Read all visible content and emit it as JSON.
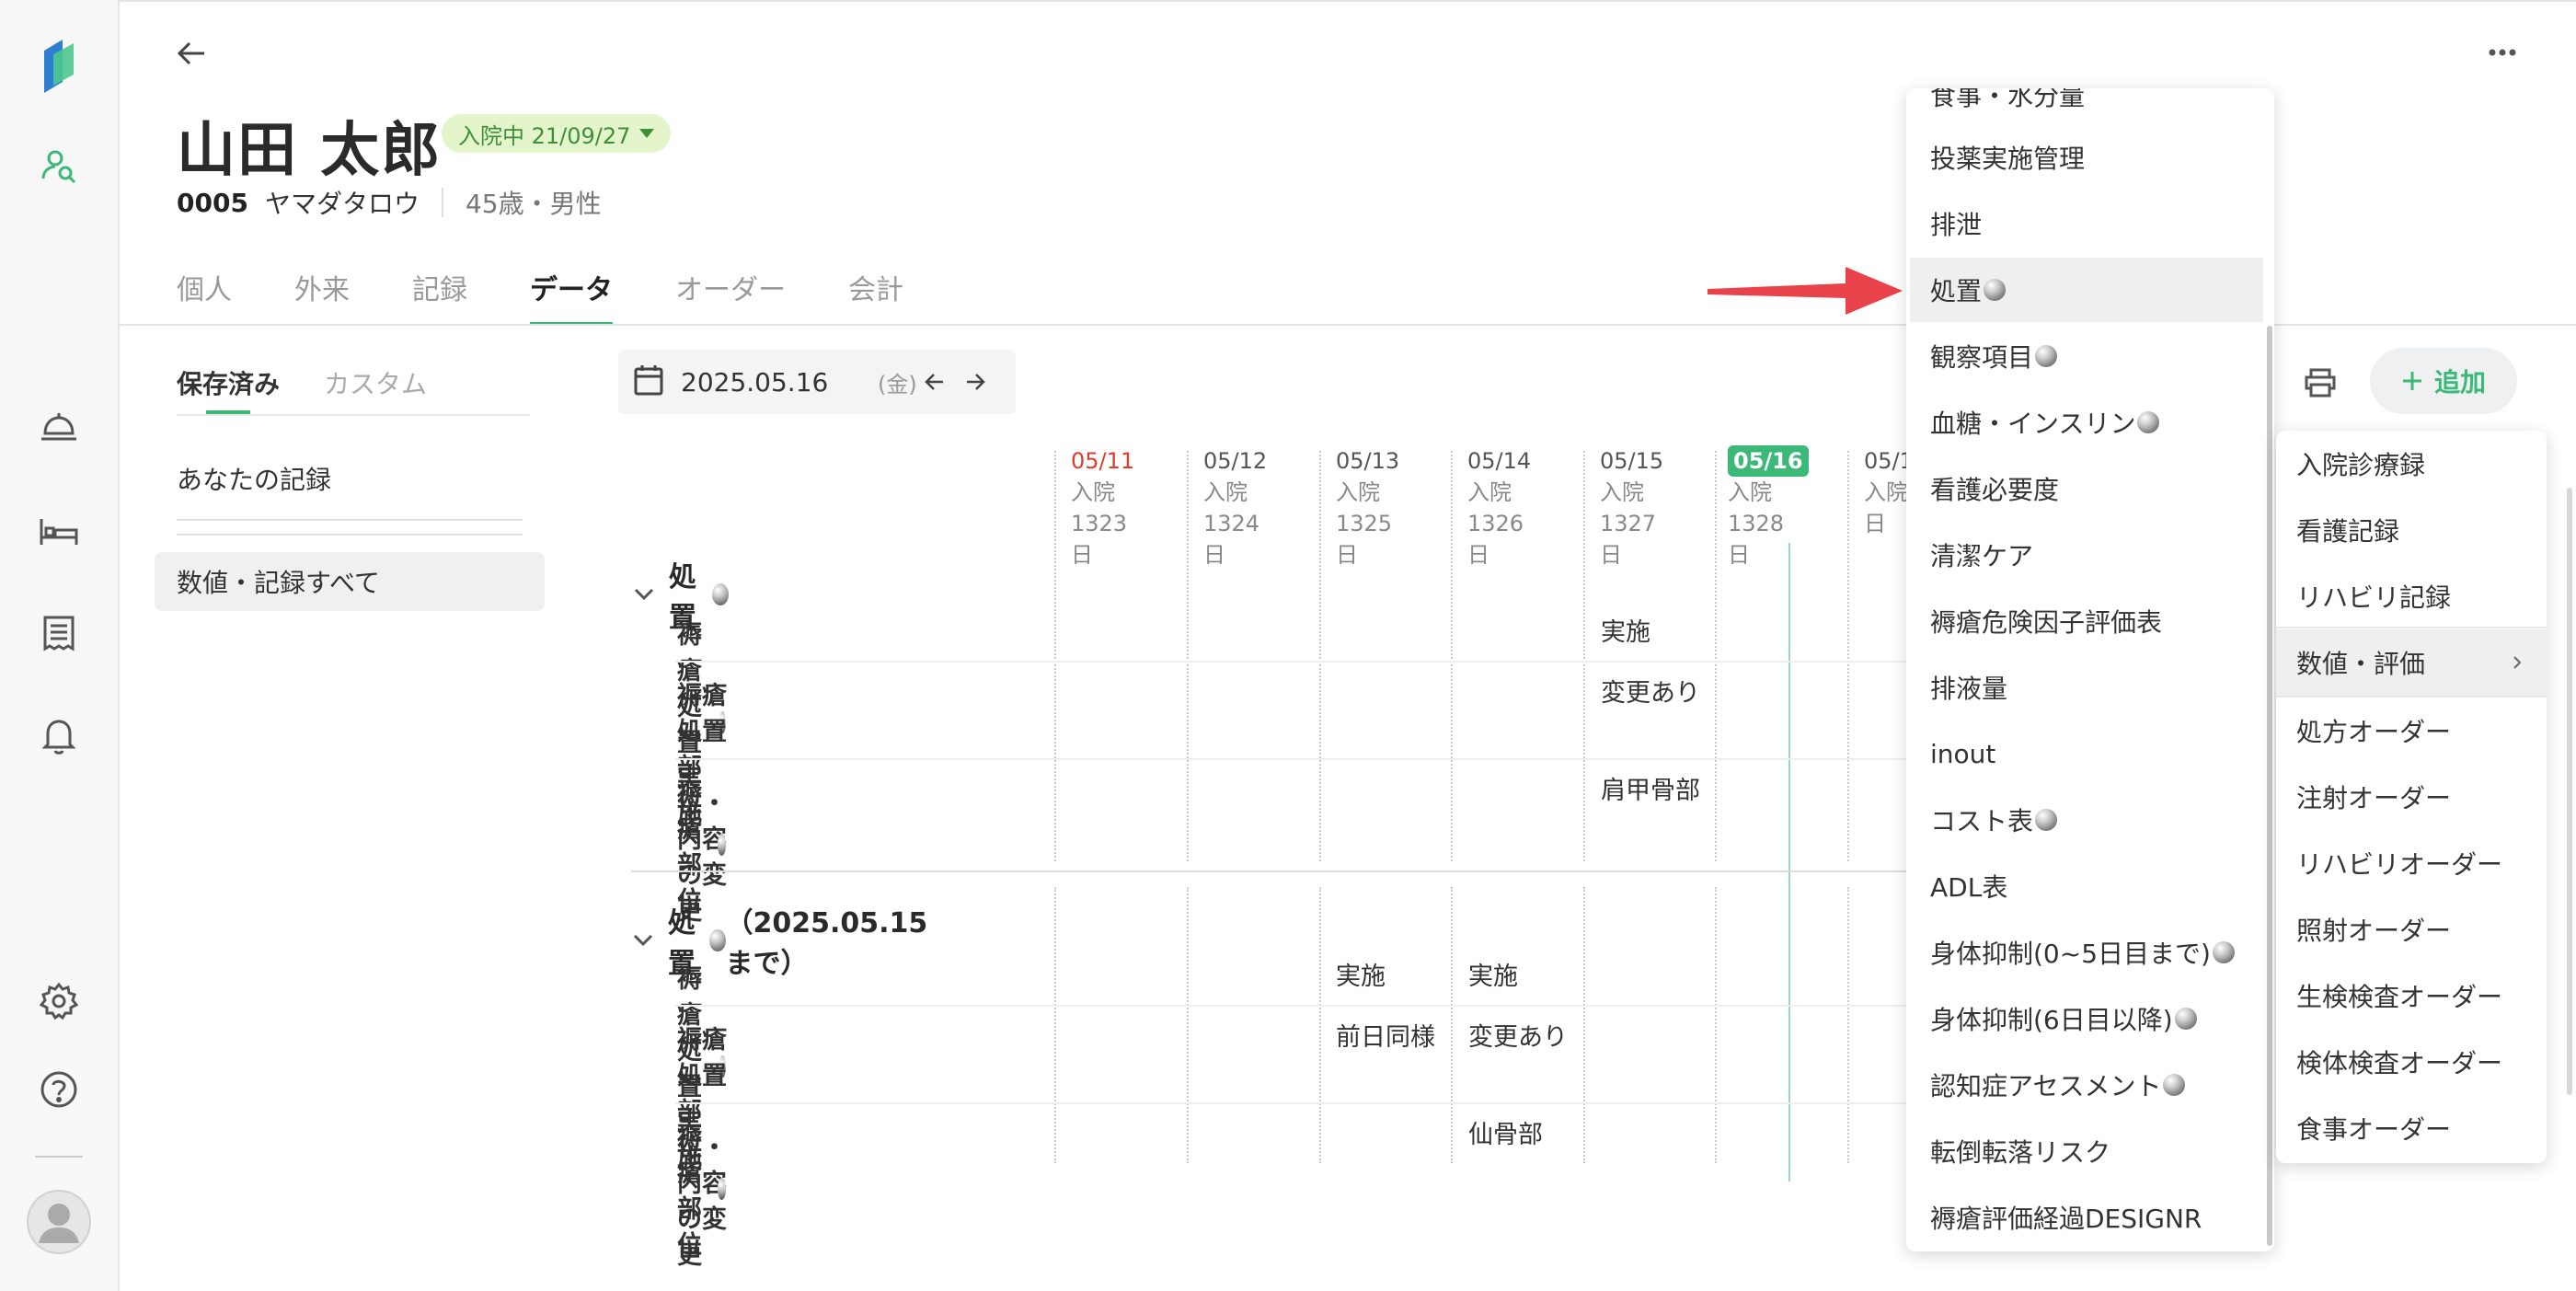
{
  "sidebar": {
    "icons": [
      "app-logo",
      "patient-search-icon",
      "bell-desk-icon",
      "bed-icon",
      "receipt-icon",
      "notification-bell-icon",
      "gear-icon",
      "help-icon",
      "avatar"
    ]
  },
  "header": {
    "patient_name": "山田 太郎",
    "status_badge": "入院中 21/09/27",
    "patient_id": "0005",
    "patient_kana": "ヤマダタロウ",
    "age_sex": "45歳・男性"
  },
  "tabs": [
    {
      "label": "個人"
    },
    {
      "label": "外来"
    },
    {
      "label": "記録"
    },
    {
      "label": "データ",
      "active": true
    },
    {
      "label": "オーダー"
    },
    {
      "label": "会計"
    }
  ],
  "left_pane": {
    "subtabs": [
      {
        "label": "保存済み",
        "active": true
      },
      {
        "label": "カスタム"
      }
    ],
    "item_your_records": "あなたの記録",
    "item_all": "数値・記録すべて"
  },
  "datebar": {
    "date": "2025.05.16",
    "weekday": "(金)"
  },
  "columns": [
    {
      "date": "05/11",
      "sub": "入院1323",
      "unit": "日",
      "style": "red"
    },
    {
      "date": "05/12",
      "sub": "入院1324",
      "unit": "日"
    },
    {
      "date": "05/13",
      "sub": "入院1325",
      "unit": "日"
    },
    {
      "date": "05/14",
      "sub": "入院1326",
      "unit": "日"
    },
    {
      "date": "05/15",
      "sub": "入院1327",
      "unit": "日"
    },
    {
      "date": "05/16",
      "sub": "入院1328",
      "unit": "日",
      "style": "today"
    },
    {
      "date": "05/1",
      "sub": "入院",
      "unit": "日"
    }
  ],
  "sections": [
    {
      "title": "処置",
      "rows": [
        {
          "label": "褥瘡処置実施",
          "orb": true,
          "cells": {
            "col4": "実施"
          }
        },
        {
          "label": "褥瘡処置部位・内容の変更",
          "orb": false,
          "cells": {
            "col4": "変更あり"
          }
        },
        {
          "label": "褥瘡部位",
          "orb": true,
          "cells": {
            "col4": "肩甲骨部"
          }
        }
      ]
    },
    {
      "title": "処置",
      "title_suffix": "（2025.05.15まで）",
      "rows": [
        {
          "label": "褥瘡処置実施",
          "orb": true,
          "cells": {
            "col2": "実施",
            "col3": "実施"
          }
        },
        {
          "label": "褥瘡処置部位・内容の変更",
          "orb": false,
          "cells": {
            "col2": "前日同様",
            "col3": "変更あり"
          }
        },
        {
          "label": "褥瘡部位",
          "orb": true,
          "cells": {
            "col3": "仙骨部"
          }
        }
      ]
    }
  ],
  "toolbar": {
    "add_label": "追加"
  },
  "menu1": {
    "partial_top": "食事・水分量",
    "items": [
      {
        "label": "投薬実施管理",
        "orb": false
      },
      {
        "label": "排泄",
        "orb": false
      },
      {
        "label": "処置",
        "orb": true,
        "highlighted": true
      },
      {
        "label": "観察項目",
        "orb": true
      },
      {
        "label": "血糖・インスリン",
        "orb": true
      },
      {
        "label": "看護必要度",
        "orb": false
      },
      {
        "label": "清潔ケア",
        "orb": false
      },
      {
        "label": "褥瘡危険因子評価表",
        "orb": false
      },
      {
        "label": "排液量",
        "orb": false
      },
      {
        "label": "inout",
        "orb": false
      },
      {
        "label": "コスト表",
        "orb": true
      },
      {
        "label": "ADL表",
        "orb": false
      },
      {
        "label": "身体抑制(0~5日目まで)",
        "orb": true
      },
      {
        "label": "身体抑制(6日目以降)",
        "orb": true
      },
      {
        "label": "認知症アセスメント",
        "orb": true
      },
      {
        "label": "転倒転落リスク",
        "orb": false
      },
      {
        "label": "褥瘡評価経過DESIGNR",
        "orb": false
      }
    ]
  },
  "menu2": {
    "items": [
      {
        "label": "入院診療録"
      },
      {
        "label": "看護記録"
      },
      {
        "label": "リハビリ記録"
      },
      {
        "label": "数値・評価",
        "highlighted": true,
        "submenu": true
      },
      {
        "label": "処方オーダー"
      },
      {
        "label": "注射オーダー"
      },
      {
        "label": "リハビリオーダー"
      },
      {
        "label": "照射オーダー"
      },
      {
        "label": "生検検査オーダー"
      },
      {
        "label": "検体検査オーダー"
      },
      {
        "label": "食事オーダー"
      }
    ]
  },
  "colors": {
    "accent": "#3cb878",
    "badge_bg": "#e4f5cc",
    "badge_text": "#3d8f3a",
    "sunday": "#e03c2a",
    "arrow": "#e8434a"
  }
}
